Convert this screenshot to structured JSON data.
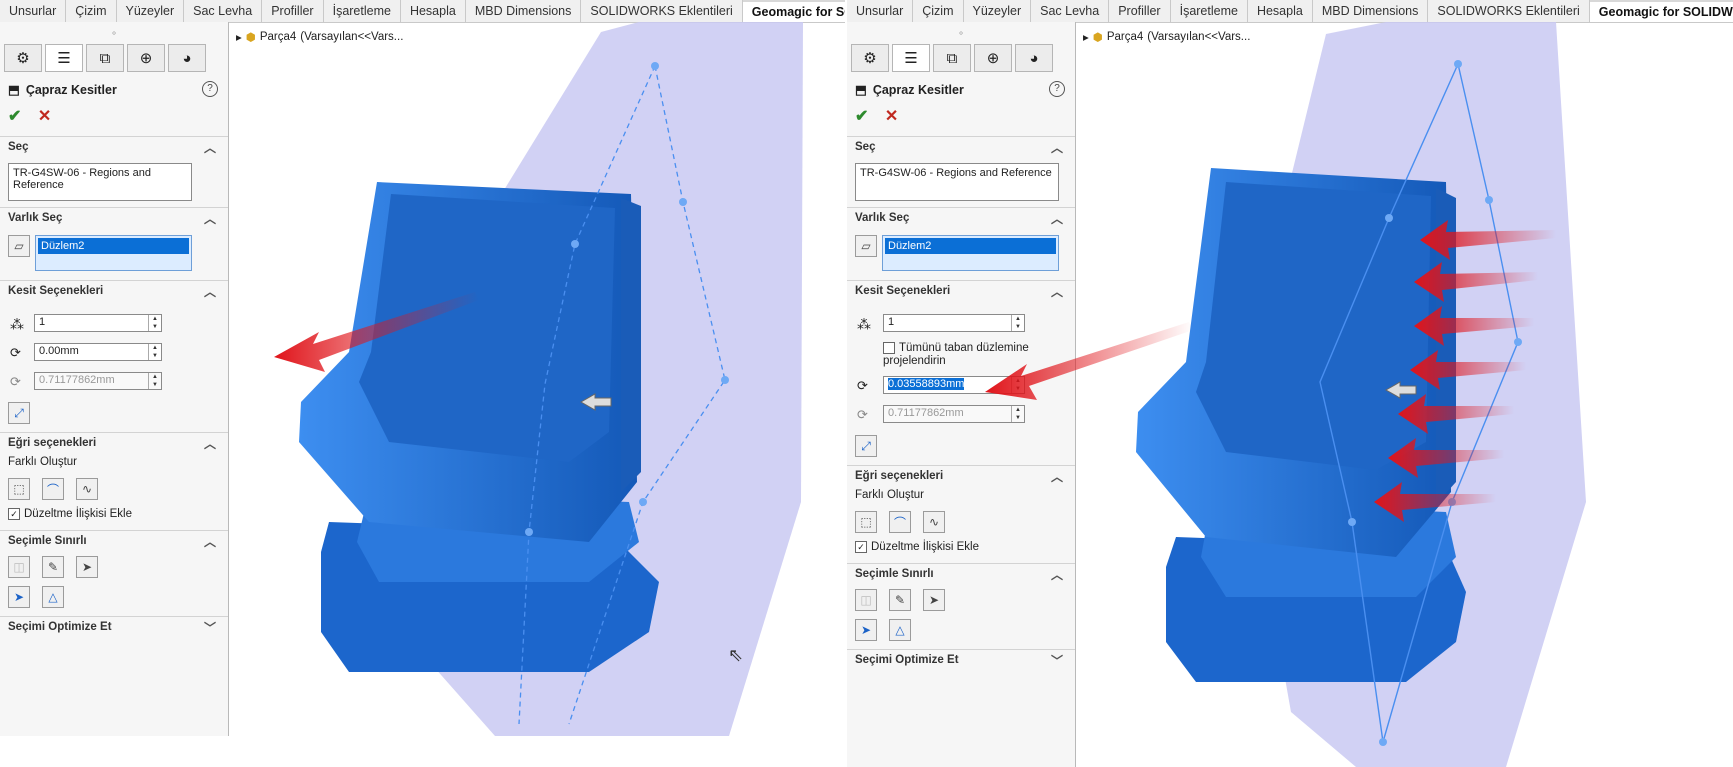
{
  "colors": {
    "model_blue": "#1f72d6",
    "plane_fill": "#c9c9f2",
    "arrow_red": "#e0141a",
    "selection_blue": "#0b6fd6"
  },
  "ribbon_tabs": [
    "Unsurlar",
    "Çizim",
    "Yüzeyler",
    "Sac Levha",
    "Profiller",
    "İşaretleme",
    "Hesapla",
    "MBD Dimensions",
    "SOLIDWORKS Eklentileri",
    "Geomagic for SOLIDWORKS"
  ],
  "active_tab": "Geomagic for SOLIDWORKS",
  "manager_tab_icons": [
    "feature-manager-icon",
    "property-manager-icon",
    "config-manager-icon",
    "dimxpert-icon",
    "display-manager-icon"
  ],
  "feature_tree": {
    "part_label": "Parça4",
    "config_label": "(Varsayılan<<Vars..."
  },
  "panel": {
    "title": "Çapraz Kesitler",
    "help": "?",
    "ok": "✔",
    "cancel": "✕",
    "select_section": {
      "header": "Seç",
      "value": "TR-G4SW-06 - Regions and Reference"
    },
    "entity_section": {
      "header": "Varlık Seç",
      "item": "Düzlem2"
    },
    "section_options": {
      "header": "Kesit Seçenekleri",
      "count": "1",
      "project_checkbox": "Tümünü taban düzlemine projelendirin",
      "d2_value": "0.71177862mm"
    },
    "curve_options": {
      "header": "Eğri seçenekleri",
      "create_diff": "Farklı Oluştur",
      "fix_relation": "Düzeltme İlişkisi Ekle"
    },
    "limit_section": {
      "header": "Seçimle Sınırlı"
    },
    "optimize_section": {
      "header": "Seçimi Optimize Et"
    }
  },
  "left": {
    "d1_value": "0.00mm"
  },
  "right": {
    "d1_value": "0.03558893mm"
  }
}
